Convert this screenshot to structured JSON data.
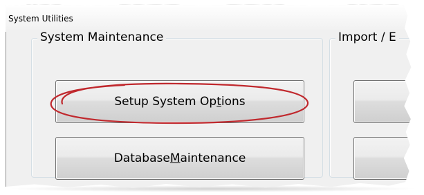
{
  "window": {
    "title": "System Utilities"
  },
  "groups": {
    "maintenance": {
      "legend": "System Maintenance",
      "buttons": {
        "setup_prefix": "Setup System Op",
        "setup_access_key": "t",
        "setup_suffix": "ions",
        "database_prefix": "Database ",
        "database_access_key": "M",
        "database_suffix": "aintenance"
      }
    },
    "import_export": {
      "legend": "Import / E"
    }
  },
  "annotation": {
    "highlight_color": "#c0282d"
  }
}
